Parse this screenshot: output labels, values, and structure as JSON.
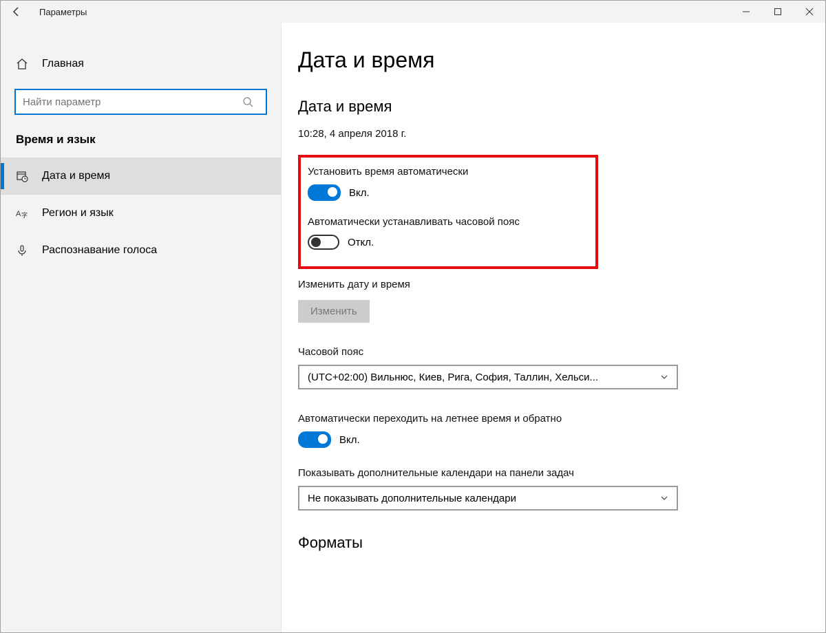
{
  "titlebar": {
    "title": "Параметры"
  },
  "sidebar": {
    "home_label": "Главная",
    "search_placeholder": "Найти параметр",
    "category_label": "Время и язык",
    "items": [
      {
        "label": "Дата и время"
      },
      {
        "label": "Регион и язык"
      },
      {
        "label": "Распознавание голоса"
      }
    ]
  },
  "main": {
    "page_title": "Дата и время",
    "section1_title": "Дата и время",
    "current_datetime": "10:28, 4 апреля 2018 г.",
    "auto_time": {
      "label": "Установить время автоматически",
      "state": "Вкл."
    },
    "auto_tz": {
      "label": "Автоматически устанавливать часовой пояс",
      "state": "Откл."
    },
    "change_dt": {
      "label": "Изменить дату и время",
      "button": "Изменить"
    },
    "tz": {
      "label": "Часовой пояс",
      "value": "(UTC+02:00) Вильнюс, Киев, Рига, София, Таллин, Хельси..."
    },
    "dst": {
      "label": "Автоматически переходить на летнее время и обратно",
      "state": "Вкл."
    },
    "extra_cal": {
      "label": "Показывать дополнительные календари на панели задач",
      "value": "Не показывать дополнительные календари"
    },
    "formats_title": "Форматы"
  }
}
